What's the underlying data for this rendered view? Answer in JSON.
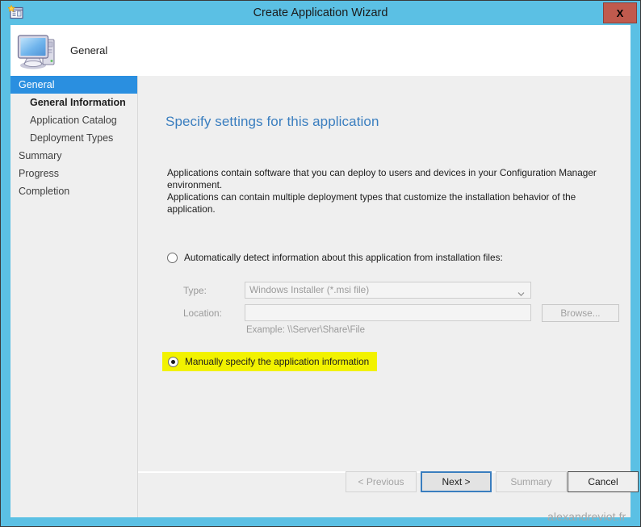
{
  "window": {
    "title": "Create Application Wizard",
    "close_label": "X",
    "frame_color": "#5bc0e4",
    "app_icon": "application-wizard-icon"
  },
  "header": {
    "icon": "computer-icon",
    "label": "General"
  },
  "sidebar": {
    "items": [
      {
        "label": "General",
        "level": 0,
        "selected": true,
        "bold": false
      },
      {
        "label": "General Information",
        "level": 1,
        "selected": false,
        "bold": true
      },
      {
        "label": "Application Catalog",
        "level": 1,
        "selected": false,
        "bold": false
      },
      {
        "label": "Deployment Types",
        "level": 1,
        "selected": false,
        "bold": false
      },
      {
        "label": "Summary",
        "level": 0,
        "selected": false,
        "bold": false
      },
      {
        "label": "Progress",
        "level": 0,
        "selected": false,
        "bold": false
      },
      {
        "label": "Completion",
        "level": 0,
        "selected": false,
        "bold": false
      }
    ]
  },
  "main": {
    "page_title": "Specify settings for this application",
    "description_line1": "Applications contain software that you can deploy to users and devices in your Configuration Manager environment.",
    "description_line2": "Applications can contain multiple deployment types that customize the installation behavior of the application.",
    "options": {
      "auto_detect": {
        "label": "Automatically detect information about this application from installation files:",
        "selected": false
      },
      "manual": {
        "label": "Manually specify the application information",
        "selected": true,
        "highlight_color": "#f2f200"
      }
    },
    "fields": {
      "type_label": "Type:",
      "type_value": "Windows Installer (*.msi file)",
      "type_chevron": "chevron-down-icon",
      "location_label": "Location:",
      "location_value": "",
      "location_placeholder": "",
      "location_example": "Example: \\\\Server\\Share\\File",
      "browse_label": "Browse..."
    }
  },
  "footer": {
    "previous_label": "< Previous",
    "next_label": "Next >",
    "summary_label": "Summary",
    "cancel_label": "Cancel"
  },
  "watermark": {
    "text": "alexandreviot.fr"
  }
}
